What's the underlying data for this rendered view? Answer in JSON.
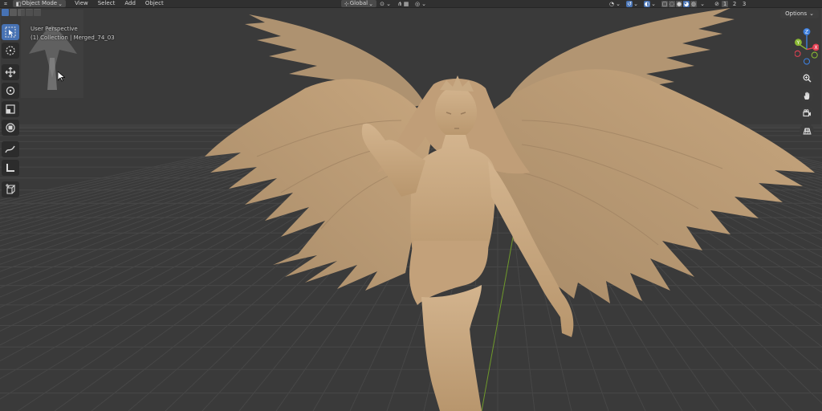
{
  "header": {
    "mode_label": "Object Mode",
    "menus": [
      "View",
      "Select",
      "Add",
      "Object"
    ],
    "transform_orientation": "Global",
    "viewport_layers": [
      "1",
      "2",
      "3"
    ]
  },
  "viewport": {
    "view_name": "User Perspective",
    "collection_object": "(1) Collection | Merged_74_03",
    "options_label": "Options"
  },
  "gizmo": {
    "axis_x": "X",
    "axis_y": "Y",
    "axis_z": "Z",
    "colors": {
      "x": "#e44053",
      "y": "#8ab833",
      "z": "#3e7fdd"
    }
  },
  "toolbar": {
    "tools": [
      "select-box",
      "cursor",
      "move",
      "rotate",
      "scale",
      "transform",
      "annotate",
      "measure",
      "add-cube"
    ],
    "active": "select-box"
  },
  "colors": {
    "model": "#c4a37c",
    "grid": "#4a4a4a",
    "background": "#3a3a3a",
    "accent": "#4772b3"
  }
}
